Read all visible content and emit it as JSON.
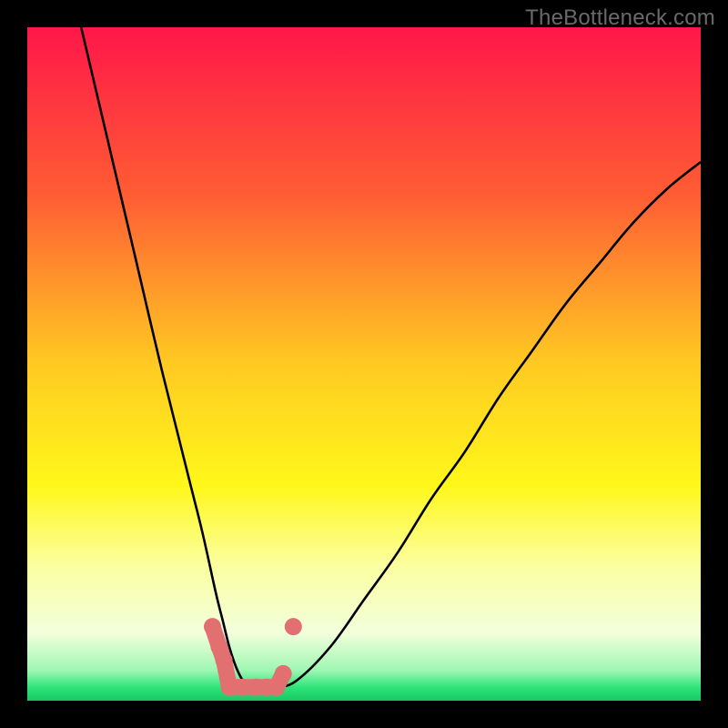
{
  "watermark": "TheBottleneck.com",
  "chart_data": {
    "type": "line",
    "title": "",
    "xlabel": "",
    "ylabel": "",
    "xlim": [
      0,
      100
    ],
    "ylim": [
      0,
      100
    ],
    "grid": false,
    "legend": false,
    "annotations": [],
    "series": [
      {
        "name": "bottleneck-curve",
        "x": [
          8,
          12,
          16,
          20,
          24,
          26,
          28,
          29,
          30,
          31,
          32,
          33,
          35,
          37,
          40,
          45,
          50,
          55,
          60,
          65,
          70,
          75,
          80,
          85,
          90,
          95,
          100
        ],
        "y": [
          100,
          83,
          66,
          49,
          33,
          25,
          16,
          12,
          8,
          5,
          3,
          2,
          2,
          2,
          3,
          8,
          15,
          22,
          30,
          37,
          45,
          52,
          59,
          65,
          71,
          76,
          80
        ]
      }
    ],
    "markers": {
      "name": "highlight-dots",
      "color": "#e27070",
      "points": [
        {
          "x": 27.5,
          "y": 11
        },
        {
          "x": 28.5,
          "y": 8
        },
        {
          "x": 29.2,
          "y": 6
        },
        {
          "x": 30.0,
          "y": 2
        },
        {
          "x": 32.0,
          "y": 2
        },
        {
          "x": 34.0,
          "y": 2
        },
        {
          "x": 35.5,
          "y": 2
        },
        {
          "x": 37.0,
          "y": 2
        },
        {
          "x": 38.0,
          "y": 4
        },
        {
          "x": 39.5,
          "y": 11
        }
      ]
    },
    "background_gradient": {
      "type": "vertical",
      "stops": [
        {
          "pos": 0.0,
          "color": "#ff1749"
        },
        {
          "pos": 0.25,
          "color": "#ff5d34"
        },
        {
          "pos": 0.5,
          "color": "#ffca22"
        },
        {
          "pos": 0.68,
          "color": "#fff71a"
        },
        {
          "pos": 0.8,
          "color": "#fbffa1"
        },
        {
          "pos": 0.9,
          "color": "#f2ffdc"
        },
        {
          "pos": 0.955,
          "color": "#9ef7b3"
        },
        {
          "pos": 0.98,
          "color": "#2ee47a"
        },
        {
          "pos": 1.0,
          "color": "#18c765"
        }
      ]
    }
  }
}
